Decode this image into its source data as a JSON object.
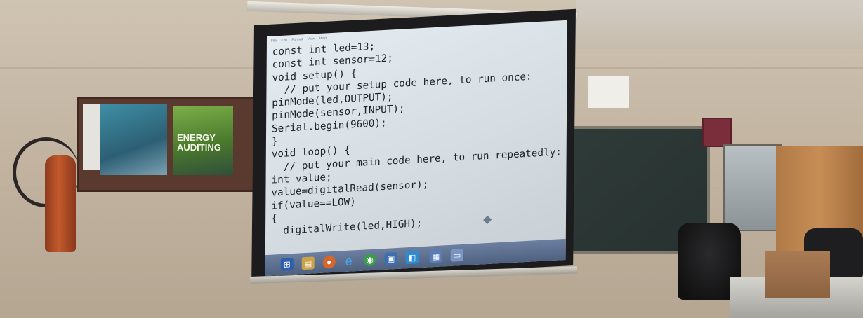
{
  "editor": {
    "menu": [
      "File",
      "Edit",
      "Format",
      "View",
      "Help"
    ],
    "code_lines": [
      "const int led=13;",
      "const int sensor=12;",
      "void setup() {",
      "  // put your setup code here, to run once:",
      "pinMode(led,OUTPUT);",
      "pinMode(sensor,INPUT);",
      "Serial.begin(9600);",
      "}",
      "",
      "void loop() {",
      "  // put your main code here, to run repeatedly:",
      "int value;",
      "value=digitalRead(sensor);",
      "if(value==LOW)",
      "{",
      "  digitalWrite(led,HIGH);"
    ]
  },
  "poster": {
    "title": "ENERGY AUDITING"
  },
  "taskbar": {
    "icons": [
      "start-icon",
      "file-explorer-icon",
      "firefox-icon",
      "internet-explorer-icon",
      "chrome-icon",
      "store-icon",
      "ie-icon",
      "app-icon"
    ]
  },
  "colors": {
    "screen_bg": "#dde4ea",
    "taskbar": "#5a6d8c",
    "wall": "#c7b9a6"
  }
}
